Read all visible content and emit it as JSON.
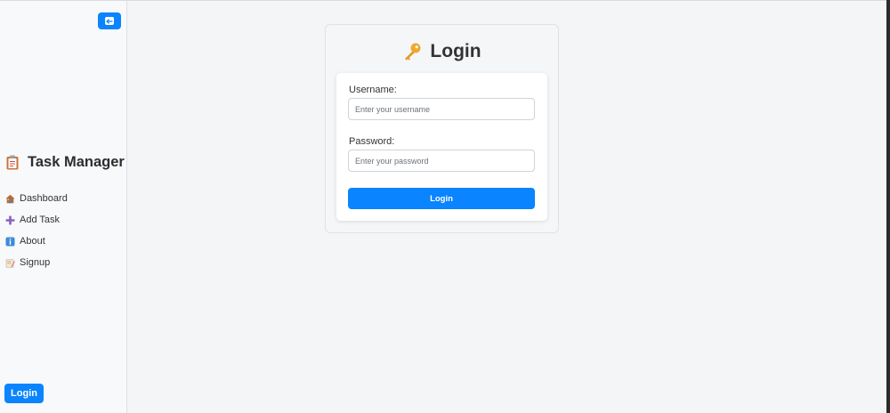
{
  "sidebar": {
    "toggle_icon": "arrow-left-icon",
    "brand": {
      "icon": "clipboard-icon",
      "title": "Task Manager"
    },
    "items": [
      {
        "label": "Dashboard",
        "icon": "house-icon"
      },
      {
        "label": "Add Task",
        "icon": "plus-icon"
      },
      {
        "label": "About",
        "icon": "info-icon"
      },
      {
        "label": "Signup",
        "icon": "memo-icon"
      }
    ],
    "login_label": "Login"
  },
  "login": {
    "icon": "key-icon",
    "title": "Login",
    "username": {
      "label": "Username:",
      "placeholder": "Enter your username",
      "value": ""
    },
    "password": {
      "label": "Password:",
      "placeholder": "Enter your password",
      "value": ""
    },
    "submit_label": "Login"
  },
  "colors": {
    "accent": "#0a84ff",
    "sidebar_bg": "#f8f9fb",
    "page_bg": "#f4f5f7"
  }
}
